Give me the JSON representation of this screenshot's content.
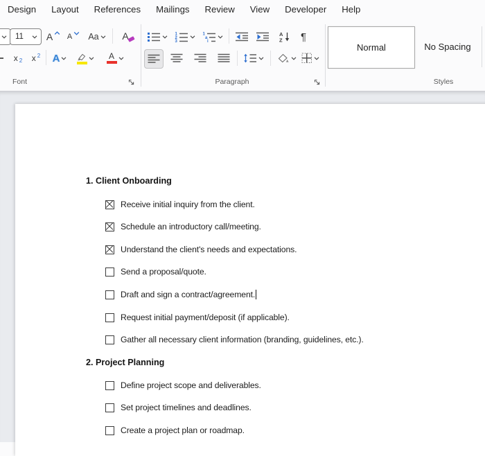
{
  "ribbon": {
    "tabs": [
      "Design",
      "Layout",
      "References",
      "Mailings",
      "Review",
      "View",
      "Developer",
      "Help"
    ],
    "font_group": {
      "label": "Font",
      "font_size_value": "11",
      "glyphs": {
        "grow_font": "A",
        "shrink_font": "A",
        "change_case": "Aa",
        "clear_formatting": "A",
        "sub_base": "x",
        "sub_mark": "2",
        "sup_base": "x",
        "sup_mark": "2",
        "text_effects": "A",
        "font_color": "A"
      }
    },
    "paragraph_group": {
      "label": "Paragraph",
      "glyphs": {
        "pilcrow": "¶",
        "sort_a": "A",
        "sort_z": "Z"
      }
    },
    "styles_group": {
      "label": "Styles",
      "styles": [
        {
          "name": "Normal",
          "selected": true
        },
        {
          "name": "No Spacing",
          "selected": false
        }
      ]
    }
  },
  "colors": {
    "accent_blue": "#2e6fd0",
    "highlight_yellow": "#f7e700",
    "font_color_red": "#e8322c",
    "clear_format_purple": "#b73bbf",
    "doc_background": "#e9ebef",
    "selected_style_border": "#a8a8a8"
  },
  "document": {
    "sections": [
      {
        "heading": "1. Client Onboarding",
        "items": [
          {
            "checked": true,
            "text": "Receive initial inquiry from the client."
          },
          {
            "checked": true,
            "text": "Schedule an introductory call/meeting."
          },
          {
            "checked": true,
            "text": "Understand the client's needs and expectations."
          },
          {
            "checked": false,
            "text": "Send a proposal/quote."
          },
          {
            "checked": false,
            "text": "Draft and sign a contract/agreement.",
            "cursor": true
          },
          {
            "checked": false,
            "text": "Request initial payment/deposit (if applicable)."
          },
          {
            "checked": false,
            "text": "Gather all necessary client information (branding, guidelines, etc.)."
          }
        ]
      },
      {
        "heading": "2. Project Planning",
        "items": [
          {
            "checked": false,
            "text": "Define project scope and deliverables."
          },
          {
            "checked": false,
            "text": "Set project timelines and deadlines."
          },
          {
            "checked": false,
            "text": "Create a project plan or roadmap."
          }
        ]
      }
    ]
  }
}
